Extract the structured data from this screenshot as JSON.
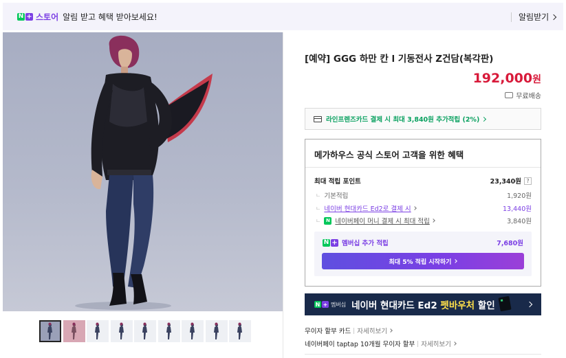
{
  "banner": {
    "badge_n": "N",
    "badge_plus": "+",
    "store": "스토어",
    "message": "알림 받고 혜택 받아보세요!",
    "right_action": "알림받기"
  },
  "gallery": {
    "thumbnail_count": 9,
    "selected_index": 0
  },
  "product": {
    "title": "[예약] GGG 하만 칸 l 기동전사 Z건담(복각판)",
    "price": "192,000",
    "currency": "원",
    "shipping": "무료배송"
  },
  "card_promo": {
    "text": "라인프렌즈카드 결제 시 최대 3,840원 추가적립 (2%)"
  },
  "benefits": {
    "title": "메가하우스 공식 스토어 고객을 위한 혜택",
    "max_points_label": "최대 적립 포인트",
    "max_points_value": "23,340원",
    "help": "?",
    "rows": [
      {
        "label": "기본적립",
        "value": "1,920원"
      },
      {
        "label": "네이버 현대카드 Ed2로 결제 시",
        "value": "13,440원"
      },
      {
        "label": "네이버페이 머니 결제 시 최대 적립",
        "value": "3,840원",
        "badge": "N"
      }
    ],
    "membership_label": "멤버십 추가 적립",
    "membership_value": "7,680원",
    "membership_button": "최대 5% 적립 시작하기"
  },
  "ad": {
    "tag": "멤버십",
    "text_prefix": "네이버 현대카드 Ed2 ",
    "text_highlight": "펫바우처",
    "text_suffix": " 할인"
  },
  "info": [
    {
      "label": "무이자 할부 카드",
      "more": "자세히보기"
    },
    {
      "label": "네이버페이 taptap 10개월 무이자 할부",
      "more": "자세히보기"
    }
  ],
  "colors": {
    "accent_purple": "#7b3fe4",
    "price_red": "#d81a3a",
    "naver_green": "#03c75a",
    "ad_navy": "#192a4a"
  }
}
